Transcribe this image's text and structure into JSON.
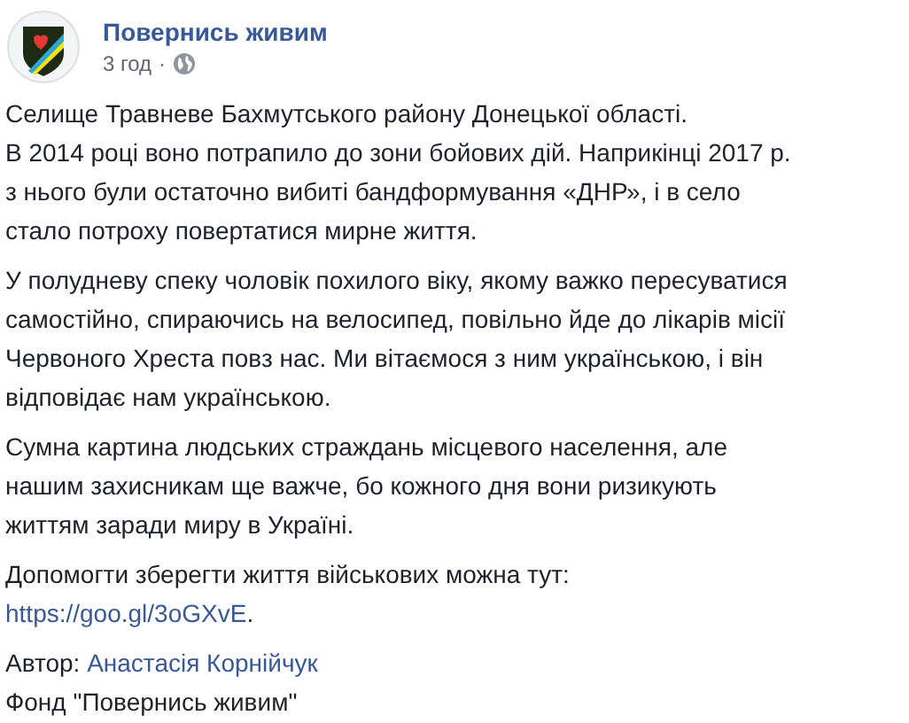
{
  "post": {
    "author": "Повернись живим",
    "time": "3 год",
    "separator": "·"
  },
  "paragraphs": [
    {
      "lines": [
        "Селище Травневе Бахмутського району Донецької області.",
        "В 2014 році воно потрапило до зони бойових дій. Наприкінці 2017 р.",
        "з нього були остаточно вибиті бандформування «ДНР», і в село",
        "стало потроху повертатися мирне життя."
      ]
    },
    {
      "lines": [
        "У полудневу спеку чоловік похилого віку, якому важко пересуватися",
        "самостійно, спираючись на велосипед, повільно йде до лікарів місії",
        "Червоного Хреста повз нас. Ми вітаємося з ним українською, і він",
        "відповідає нам українською."
      ]
    },
    {
      "lines": [
        "Сумна картина людських страждань місцевого населення, але",
        "нашим захисникам ще важче, бо кожного дня вони ризикують",
        "життям заради миру в Україні."
      ]
    }
  ],
  "help": {
    "text": "Допомогти зберегти життя військових можна тут:",
    "link": "https://goo.gl/3oGXvE",
    "trailing": "."
  },
  "credit": {
    "label": "Автор:",
    "name": "Анастасія Корнійчук",
    "fund": "Фонд \"Повернись живим\""
  }
}
